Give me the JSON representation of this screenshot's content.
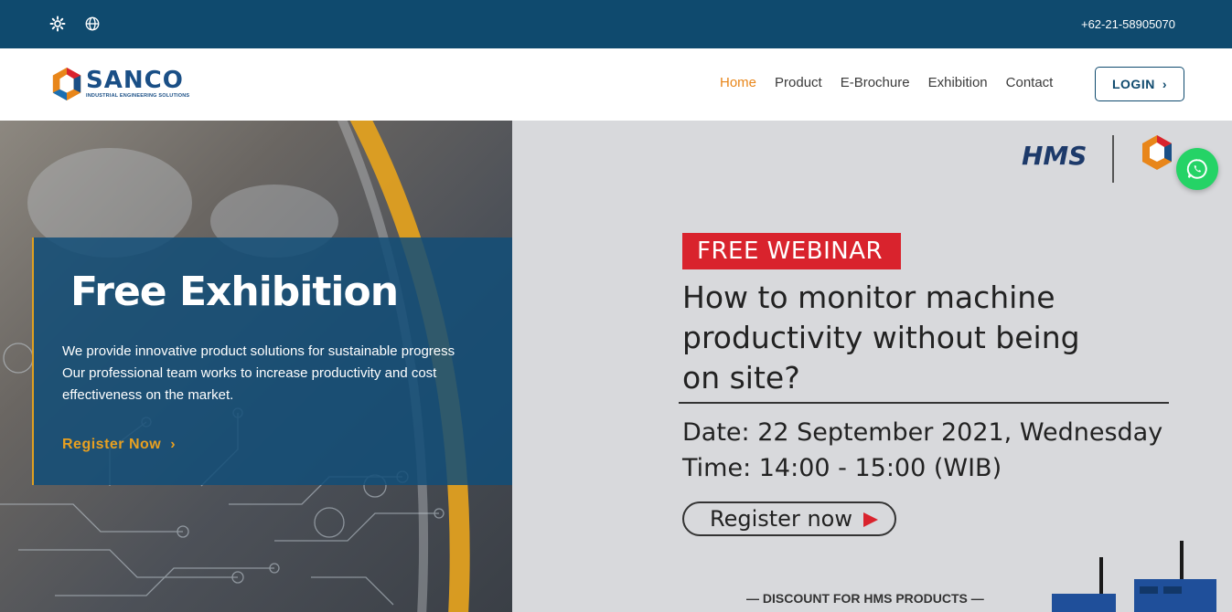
{
  "topbar": {
    "phone": "+62-21-58905070",
    "icons": [
      "settings-icon",
      "globe-icon"
    ]
  },
  "nav": {
    "logo": {
      "name": "SANCO",
      "tagline": "INDUSTRIAL ENGINEERING SOLUTIONS"
    },
    "links": [
      "Home",
      "Product",
      "E-Brochure",
      "Exhibition",
      "Contact"
    ],
    "active_link": "Home",
    "login_label": "LOGIN"
  },
  "hero": {
    "title": "Free Exhibition",
    "text_line_1": "We provide innovative product solutions for sustainable progress",
    "text_line_2": "Our professional team works to increase productivity and cost effectiveness on the market.",
    "register_label": "Register Now"
  },
  "poster": {
    "brand": "HMS",
    "badge": "FREE WEBINAR",
    "headline_1": "How to monitor machine",
    "headline_2": "productivity without being",
    "headline_3": "on site?",
    "date": "Date: 22 September 2021, Wednesday",
    "time": "Time: 14:00 - 15:00 (WIB)",
    "button": "Register now",
    "discount": "— DISCOUNT FOR HMS PRODUCTS —"
  },
  "colors": {
    "topbar": "#0f4a6e",
    "accent": "#e8861a",
    "overlay": "#124e78",
    "badge": "#d9232d",
    "whatsapp": "#25d366"
  }
}
